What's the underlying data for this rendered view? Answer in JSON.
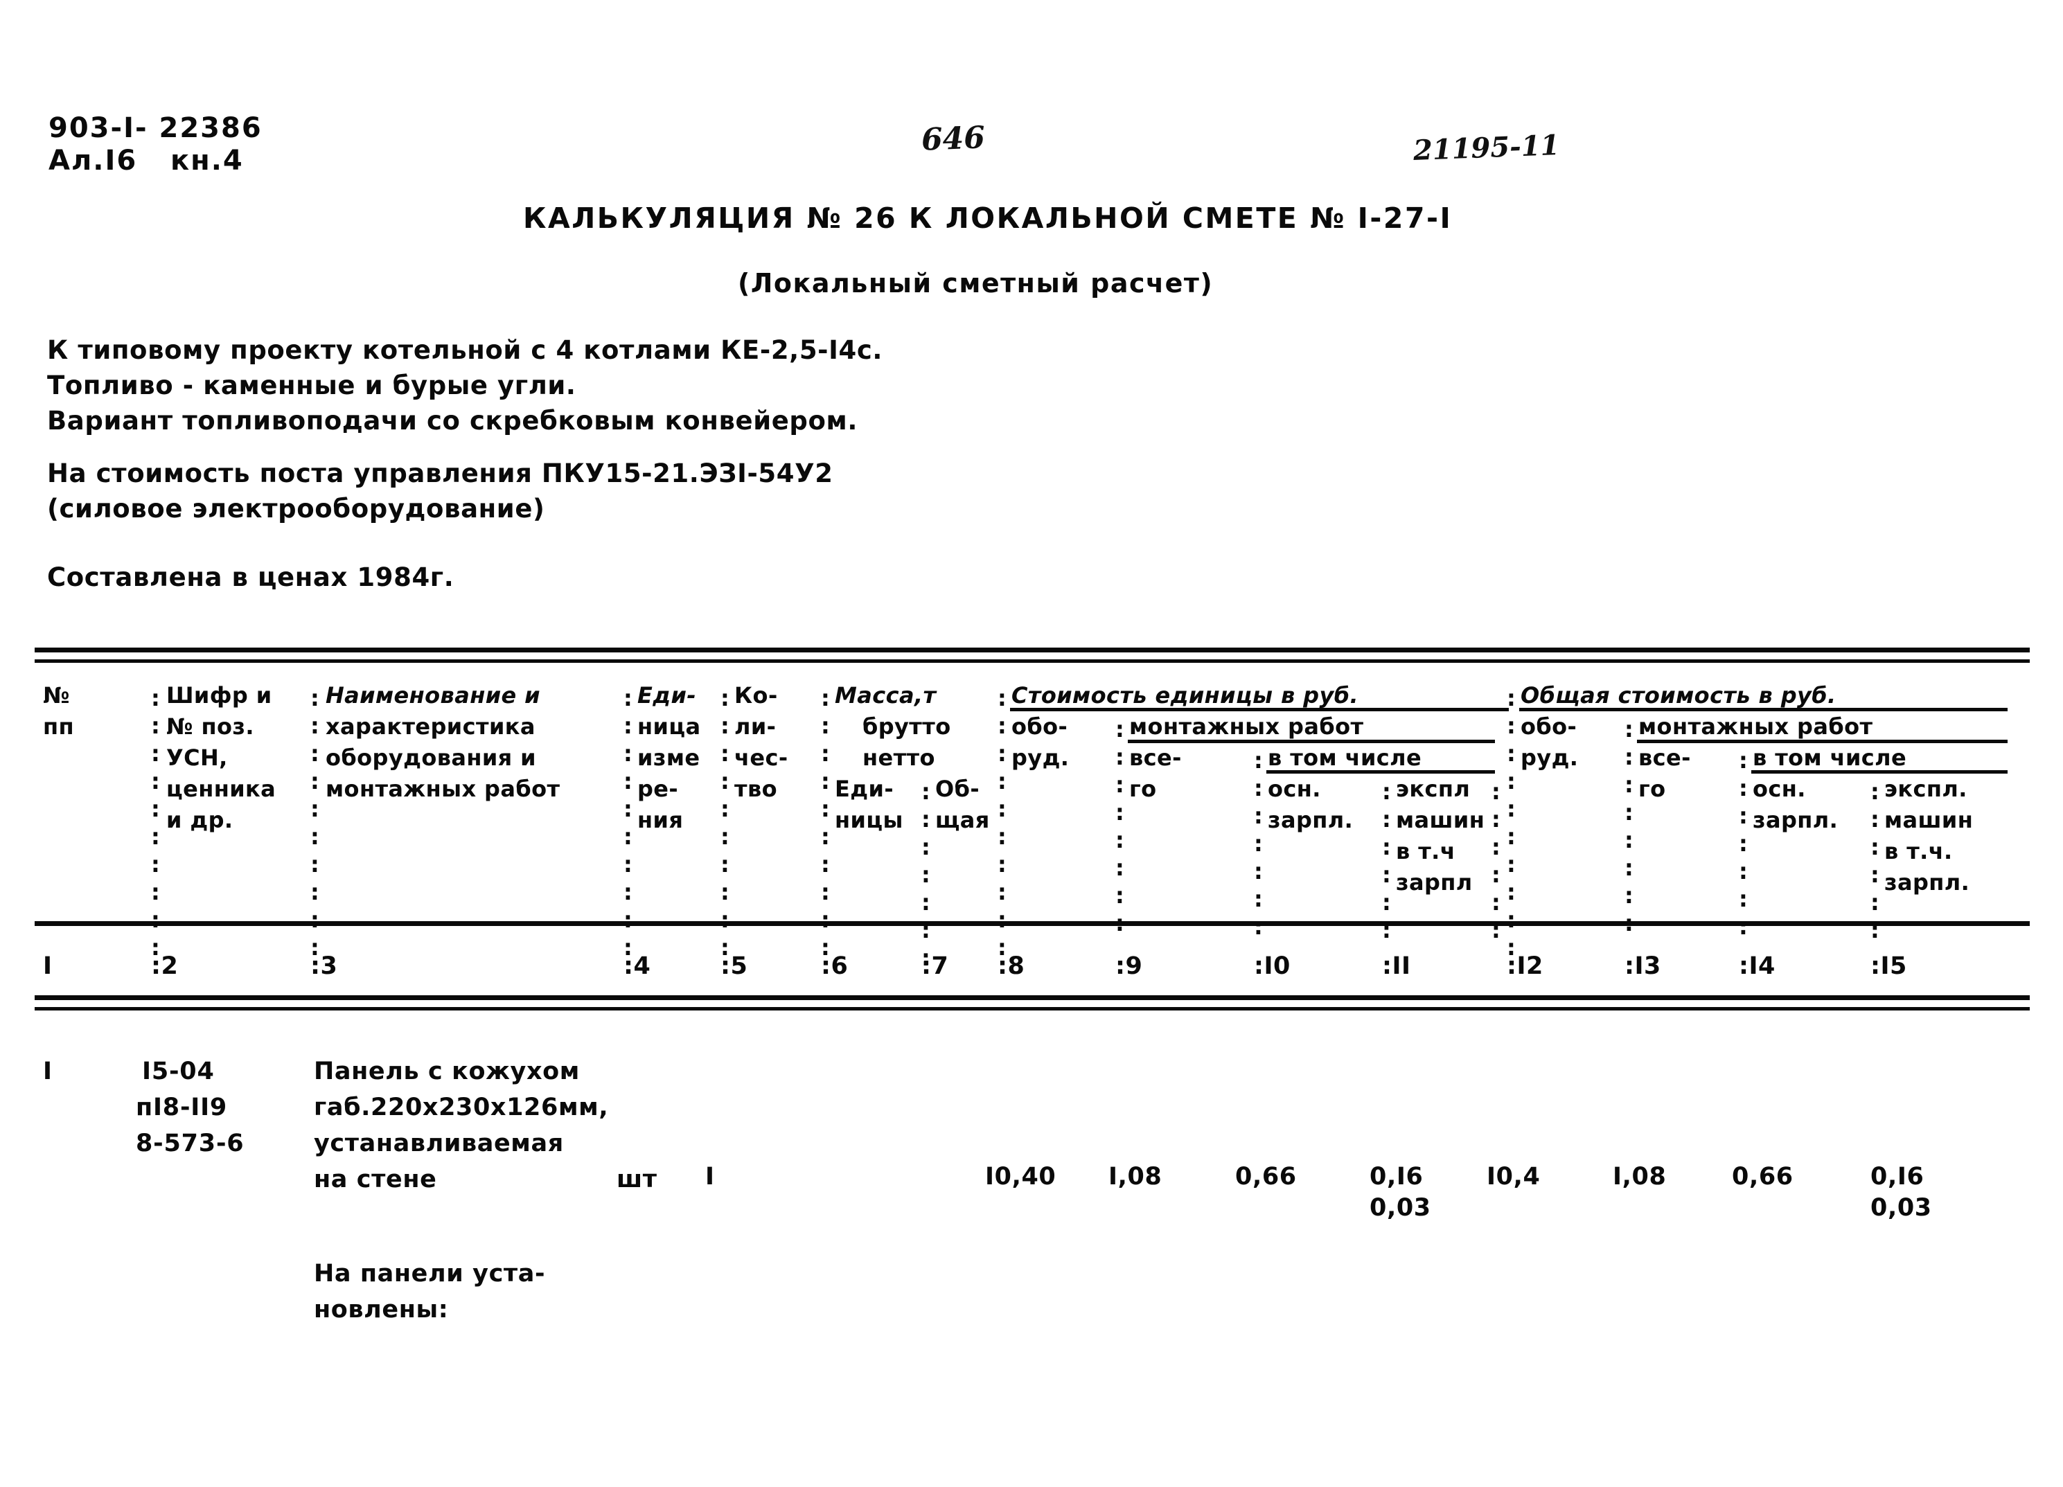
{
  "document": {
    "stamp_code_line1": "903-I- 22386",
    "stamp_code_line2": "Ал.I6   кн.4",
    "page_number_handwritten": "646",
    "archive_number_handwritten": "21195-11",
    "title": "КАЛЬКУЛЯЦИЯ № 26 К ЛОКАЛЬНОЙ СМЕТЕ № I-27-I",
    "subtitle": "(Локальный сметный расчет)",
    "intro_lines": [
      "К типовому проекту котельной с 4 котлами КЕ-2,5-I4с.",
      "Топливо - каменные и бурые угли.",
      "Вариант топливоподачи со скребковым конвейером."
    ],
    "scope_lines": [
      "На стоимость поста управления ПКУ15-21.ЭЗI-54У2",
      "(силовое электрооборудование)"
    ],
    "price_basis": "Составлена в ценах 1984г.",
    "footer_note_lines": [
      "На панели уста-",
      "новлены:"
    ]
  },
  "table": {
    "header": {
      "col1": [
        "№",
        "пп"
      ],
      "col2": [
        "Шифр и",
        "№ поз.",
        "УСН,",
        "ценника",
        "и др."
      ],
      "col3": [
        "Наименование и",
        "характеристика",
        "оборудования и",
        "монтажных работ"
      ],
      "col4": [
        "Еди-",
        "ница",
        "изме",
        "ре-",
        "ния"
      ],
      "col5": [
        "Ко-",
        "ли-",
        "чес-",
        "тво"
      ],
      "col6_7_group": "Масса,т",
      "col6_7_sub": [
        "брутто",
        "нетто"
      ],
      "col6": [
        "Еди-",
        "ницы"
      ],
      "col7": [
        "Об-",
        "щая"
      ],
      "group_unit_cost": "Стоимость единицы в руб.",
      "col8": [
        "обо-",
        "руд."
      ],
      "group_unit_install": "монтажных работ",
      "col9": [
        "все-",
        "го"
      ],
      "group_unit_including": "в том числе",
      "col10": [
        "осн.",
        "зарпл."
      ],
      "col11": [
        "экспл",
        "машин",
        "в т.ч",
        "зарпл"
      ],
      "group_total_cost": "Общая стоимость в руб.",
      "col12": [
        "обо-",
        "руд."
      ],
      "group_total_install": "монтажных работ",
      "col13": [
        "все-",
        "го"
      ],
      "group_total_including": "в том числе",
      "col14": [
        "осн.",
        "зарпл."
      ],
      "col15": [
        "экспл.",
        "машин",
        "в т.ч.",
        "зарпл."
      ]
    },
    "column_numbers": [
      "I",
      "2",
      "3",
      "4",
      "5",
      "6",
      "7",
      "8",
      "9",
      "I0",
      "II",
      "I2",
      "I3",
      "I4",
      "I5"
    ],
    "rows": [
      {
        "num": "I",
        "codes": [
          "I5-04",
          "пI8-II9",
          "8-573-6"
        ],
        "name_lines": [
          "Панель с кожухом",
          "габ.220х230х126мм,",
          "устанавливаемая",
          "на стене"
        ],
        "unit": "шт",
        "qty": "I",
        "mass_unit": "",
        "mass_total": "",
        "unit_equipment": "I0,40",
        "unit_install_total": "I,08",
        "unit_install_salary": "0,66",
        "unit_install_machines": "0,I6",
        "unit_install_machines_salary": "0,03",
        "total_equipment": "I0,4",
        "total_install_total": "I,08",
        "total_install_salary": "0,66",
        "total_install_machines": "0,I6",
        "total_install_machines_salary": "0,03"
      }
    ]
  },
  "colors": {
    "ink": "#0a0a0a",
    "paper": "#ffffff"
  }
}
